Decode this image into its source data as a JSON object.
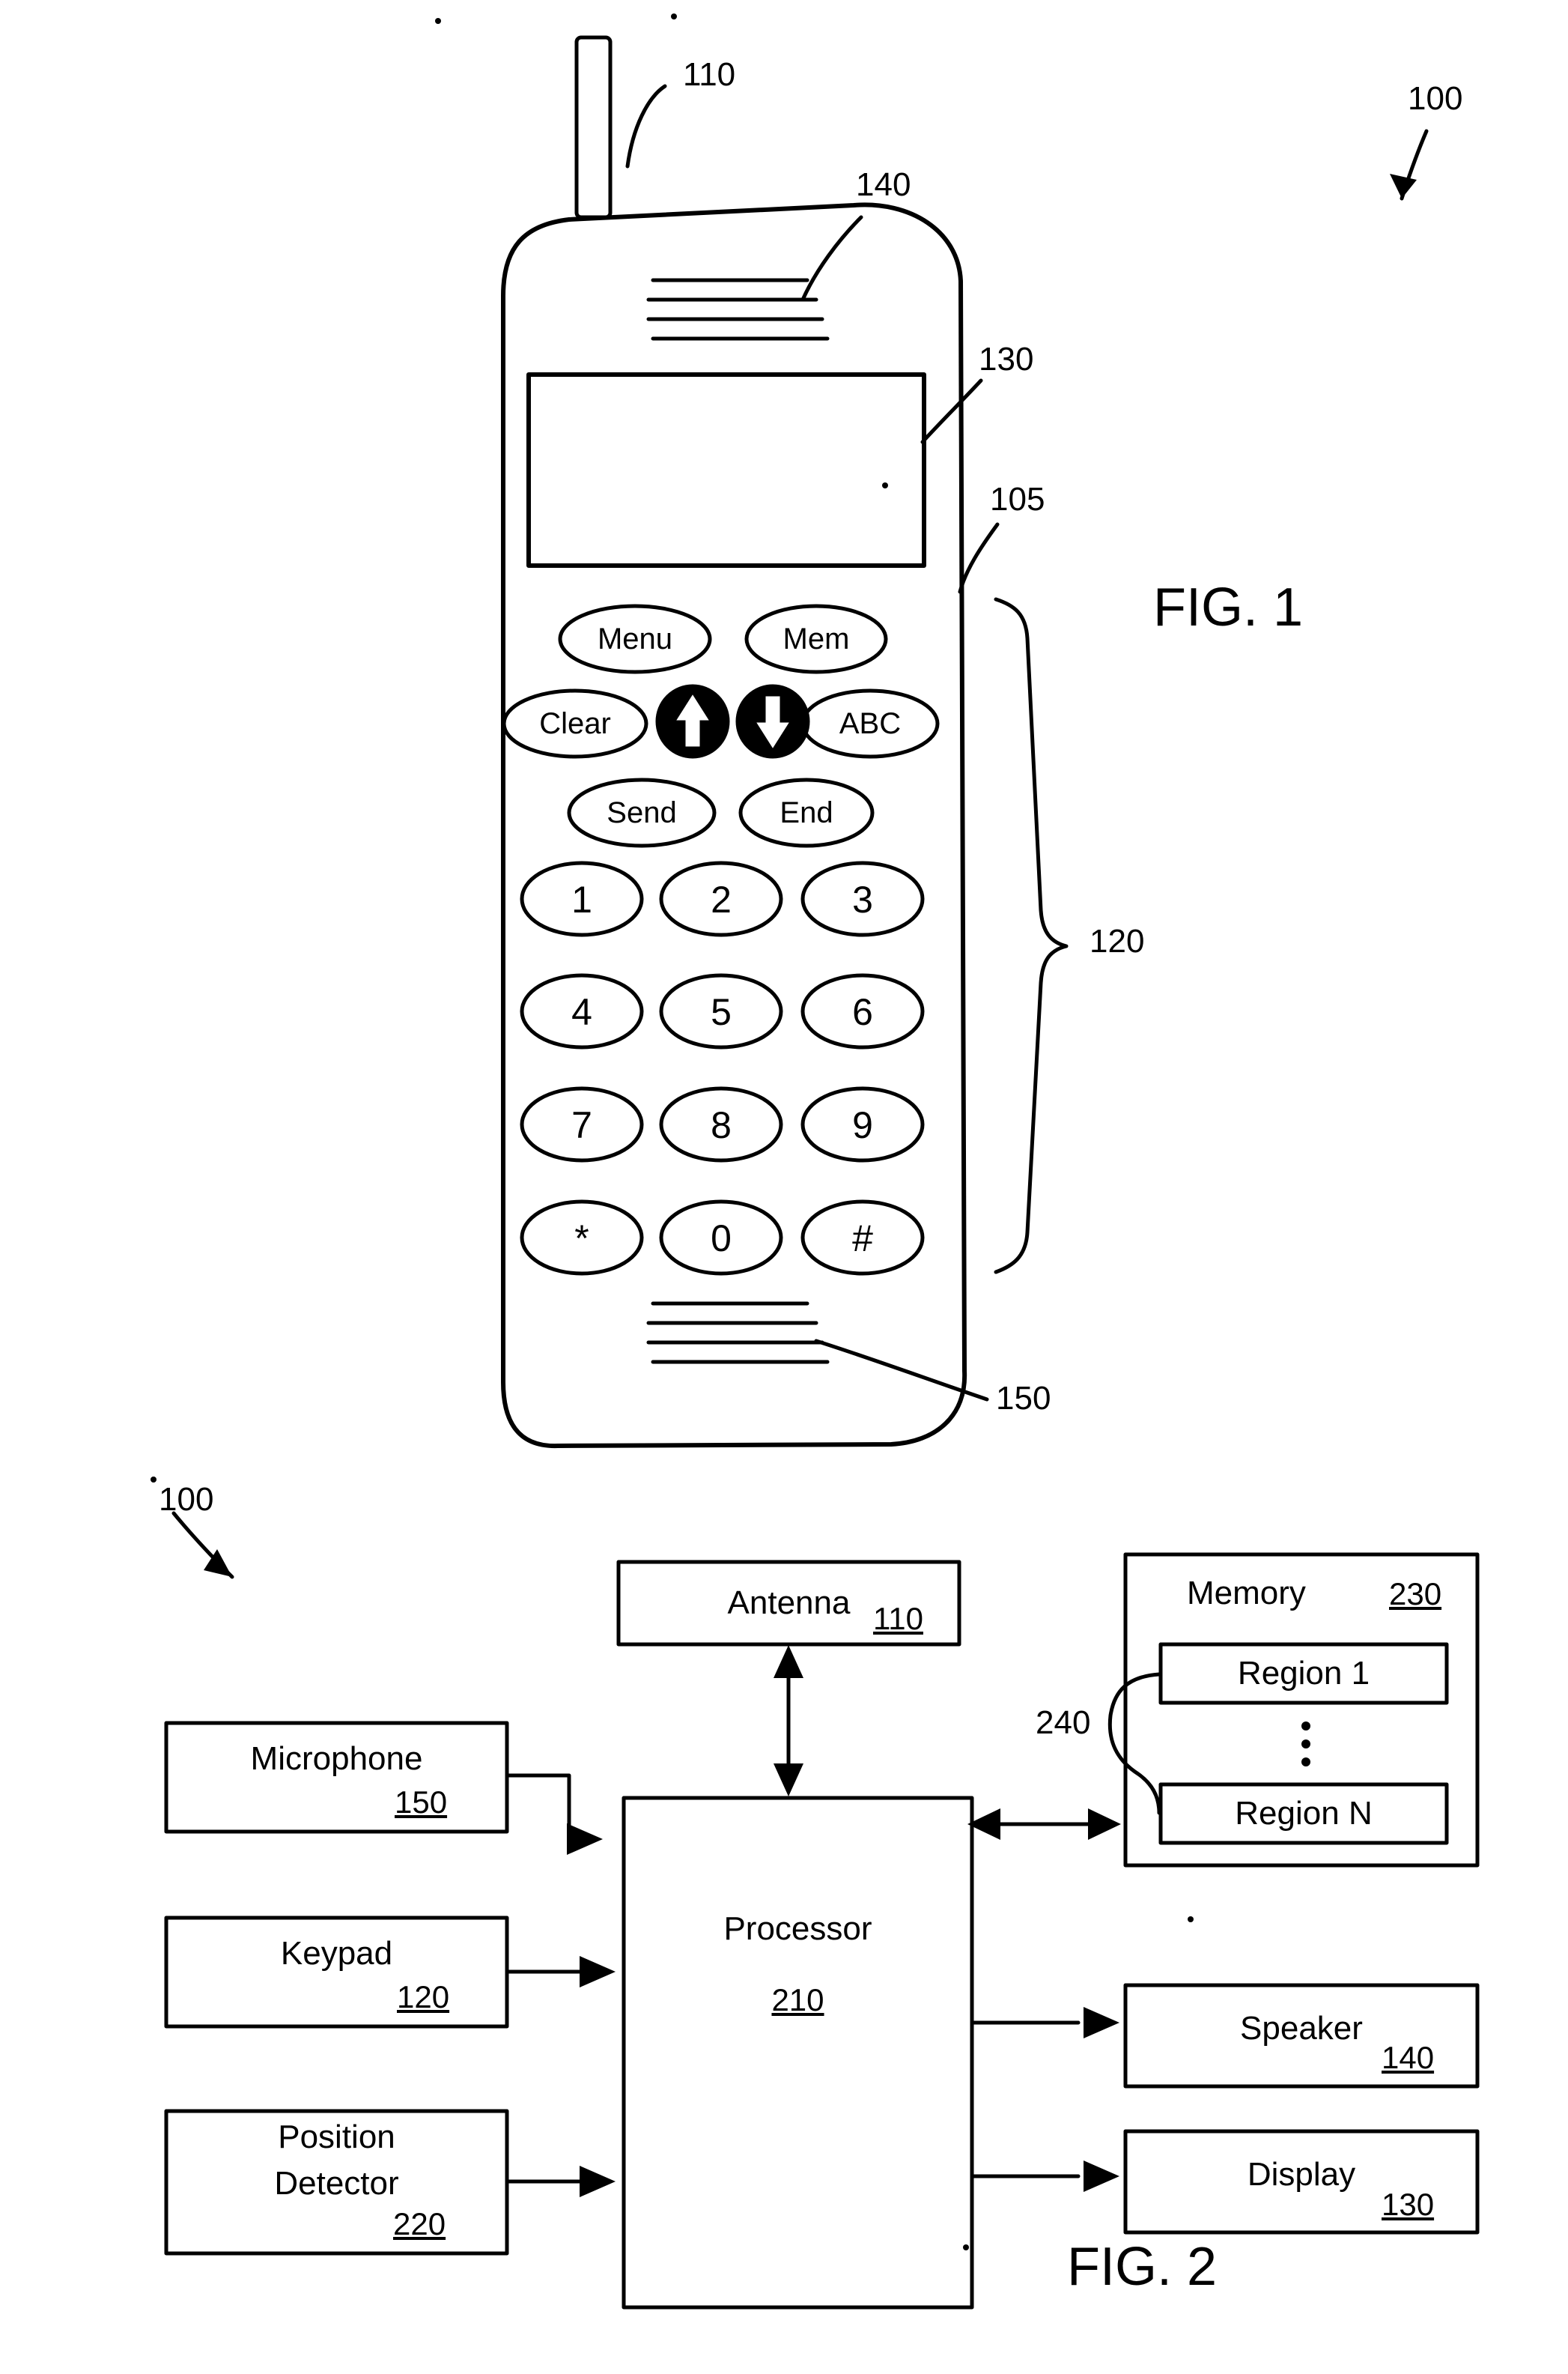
{
  "figure1": {
    "title": "FIG. 1",
    "device_ref": "100",
    "refs": {
      "antenna": "110",
      "speaker": "140",
      "display": "130",
      "keypad_bracket_top": "105",
      "keypad": "120",
      "microphone": "150"
    },
    "keys": {
      "row_soft": [
        "Menu",
        "Mem"
      ],
      "row_nav": [
        "Clear",
        "up-arrow",
        "down-arrow",
        "ABC"
      ],
      "row_call": [
        "Send",
        "End"
      ],
      "dialpad": [
        [
          "1",
          "2",
          "3"
        ],
        [
          "4",
          "5",
          "6"
        ],
        [
          "7",
          "8",
          "9"
        ],
        [
          "*",
          "0",
          "#"
        ]
      ]
    }
  },
  "figure2": {
    "title": "FIG. 2",
    "device_ref": "100",
    "blocks": {
      "antenna": {
        "label": "Antenna",
        "num": "110"
      },
      "microphone": {
        "label": "Microphone",
        "num": "150"
      },
      "keypad": {
        "label": "Keypad",
        "num": "120"
      },
      "position_detector": {
        "label_line1": "Position",
        "label_line2": "Detector",
        "num": "220"
      },
      "processor": {
        "label": "Processor",
        "num": "210"
      },
      "memory": {
        "label": "Memory",
        "num": "230"
      },
      "region_first": {
        "label": "Region 1"
      },
      "region_last": {
        "label": "Region N"
      },
      "regions_ref": "240",
      "speaker": {
        "label": "Speaker",
        "num": "140"
      },
      "display": {
        "label": "Display",
        "num": "130"
      }
    }
  }
}
